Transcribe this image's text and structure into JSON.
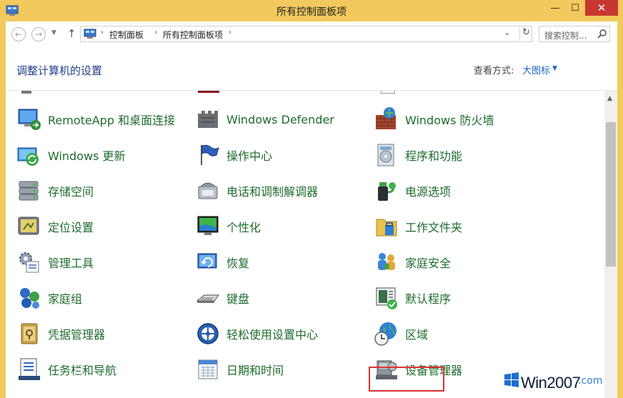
{
  "window": {
    "title": "所有控制面板项",
    "minimize": "—",
    "maximize": "☐",
    "close": "✕"
  },
  "address": {
    "back": "←",
    "forward": "→",
    "up": "↑",
    "breadcrumb": [
      "控制面板",
      "所有控制面板项"
    ],
    "separator": "›",
    "search_placeholder": "搜索控制..."
  },
  "header": {
    "title": "调整计算机的设置",
    "view_by_label": "查看方式:",
    "view_by_value": "大图标"
  },
  "columns": [
    [
      "RemoteApp 和桌面连接",
      "Windows 更新",
      "存储空间",
      "定位设置",
      "管理工具",
      "家庭组",
      "凭据管理器",
      "任务栏和导航"
    ],
    [
      "Windows Defender",
      "操作中心",
      "电话和调制解调器",
      "个性化",
      "恢复",
      "键盘",
      "轻松使用设置中心",
      "日期和时间"
    ],
    [
      "Windows 防火墙",
      "程序和功能",
      "电源选项",
      "工作文件夹",
      "家庭安全",
      "默认程序",
      "区域",
      "设备管理器"
    ]
  ],
  "highlighted_item": "区域",
  "watermark": {
    "brand": "Win2007",
    "suffix": ".com"
  },
  "colors": {
    "frame": "#f2c95d",
    "link": "#1e6b2e",
    "title": "#1f3f8c",
    "highlight": "#dd3333"
  }
}
